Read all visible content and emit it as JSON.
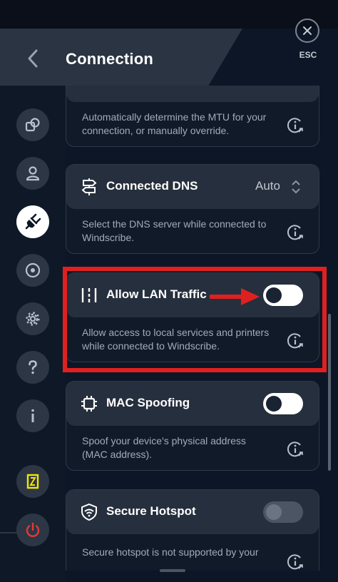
{
  "header": {
    "title": "Connection",
    "esc_label": "ESC"
  },
  "sidebar": {
    "items": [
      {
        "name": "connection-icon",
        "active": false
      },
      {
        "name": "account-icon",
        "active": false
      },
      {
        "name": "plug-icon",
        "active": true
      },
      {
        "name": "robert-icon",
        "active": false
      },
      {
        "name": "gear-icon",
        "active": false
      },
      {
        "name": "help-icon",
        "active": false
      },
      {
        "name": "about-icon",
        "active": false
      },
      {
        "name": "news-icon",
        "active": false
      },
      {
        "name": "power-icon",
        "active": false
      }
    ]
  },
  "cards": {
    "mtu": {
      "description": "Automatically determine the MTU for your connection, or manually override."
    },
    "dns": {
      "title": "Connected DNS",
      "value": "Auto",
      "description": "Select the DNS server while connected to Windscribe."
    },
    "lan": {
      "title": "Allow LAN Traffic",
      "enabled": false,
      "description": "Allow access to local services and printers while connected to Windscribe."
    },
    "mac": {
      "title": "MAC Spoofing",
      "enabled": false,
      "description": "Spoof your device's physical address (MAC address)."
    },
    "hotspot": {
      "title": "Secure Hotspot",
      "enabled": false,
      "disabled": true,
      "description": "Secure hotspot is not supported by your"
    }
  },
  "colors": {
    "highlight": "#e02020",
    "card_header": "#262f3d",
    "background": "#0d1626",
    "accent_yellow": "#f5e500",
    "power_red": "#e53935"
  }
}
